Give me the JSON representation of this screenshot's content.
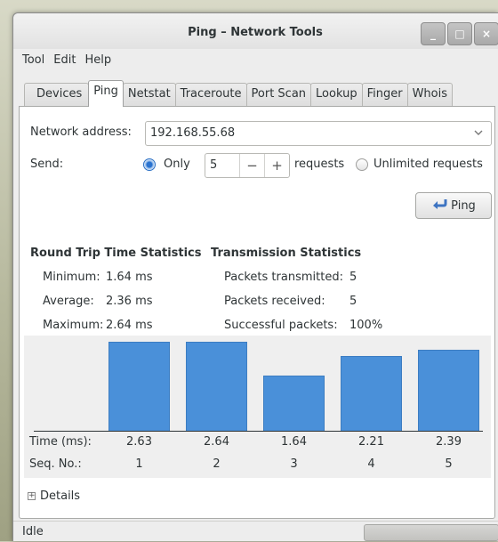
{
  "window": {
    "title": "Ping – Network Tools",
    "minimize_label": "_",
    "maximize_label": "□",
    "close_label": "×"
  },
  "menubar": [
    "Tool",
    "Edit",
    "Help"
  ],
  "tabs": [
    "Devices",
    "Ping",
    "Netstat",
    "Traceroute",
    "Port Scan",
    "Lookup",
    "Finger",
    "Whois"
  ],
  "active_tab": "Ping",
  "form": {
    "address_label": "Network address:",
    "address_value": "192.168.55.68",
    "send_label": "Send:",
    "only_label": "Only",
    "count_value": "5",
    "minus_label": "−",
    "plus_label": "+",
    "requests_label": "requests",
    "unlimited_label": "Unlimited requests",
    "send_mode": "only",
    "ping_button": "Ping"
  },
  "rtt": {
    "heading": "Round Trip Time Statistics",
    "minimum_label": "Minimum:",
    "minimum_value": "1.64 ms",
    "average_label": "Average:",
    "average_value": "2.36 ms",
    "maximum_label": "Maximum:",
    "maximum_value": "2.64 ms"
  },
  "transmission": {
    "heading": "Transmission Statistics",
    "transmitted_label": "Packets transmitted:",
    "transmitted_value": "5",
    "received_label": "Packets received:",
    "received_value": "5",
    "success_label": "Successful packets:",
    "success_value": "100%"
  },
  "chart_data": {
    "type": "bar",
    "time_label": "Time (ms):",
    "seq_label": "Seq. No.:",
    "categories": [
      "1",
      "2",
      "3",
      "4",
      "5"
    ],
    "values": [
      2.63,
      2.64,
      1.64,
      2.21,
      2.39
    ],
    "value_labels": [
      "2.63",
      "2.64",
      "1.64",
      "2.21",
      "2.39"
    ]
  },
  "details_label": "Details",
  "expander_symbol": "+",
  "status": {
    "text": "Idle"
  },
  "colors": {
    "bar": "#4a90d9",
    "radio_selected": "#2a73d0"
  },
  "icons": {
    "ping_button_icon": "ping-arrow-icon",
    "combo_icon": "chevron-down-icon"
  }
}
